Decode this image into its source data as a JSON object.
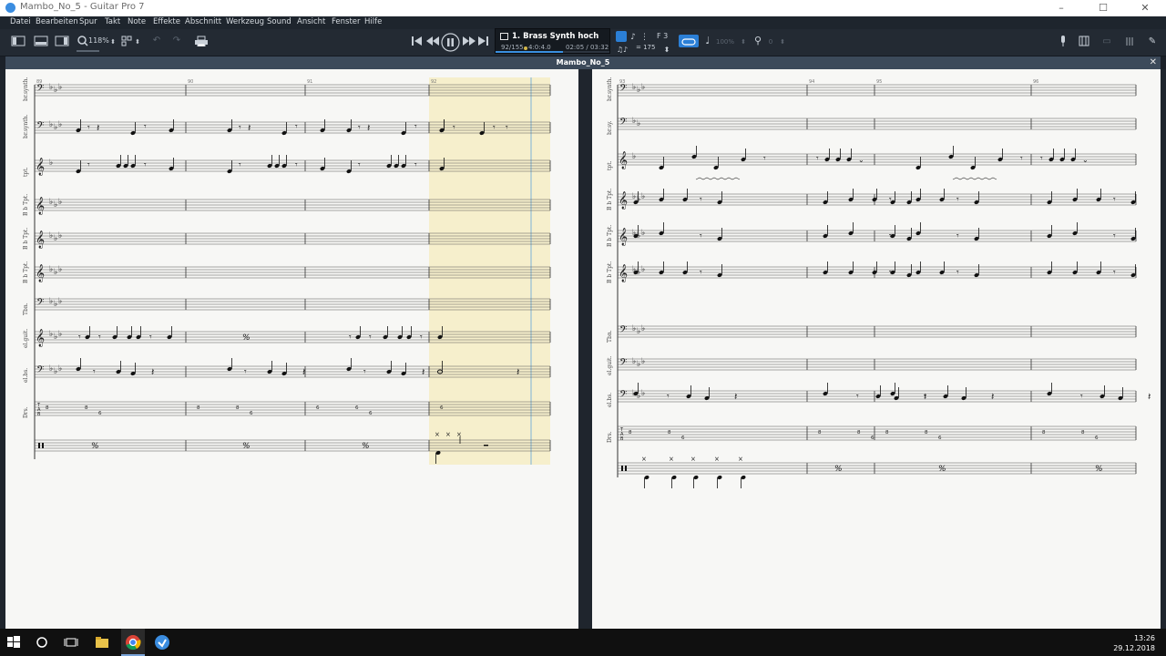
{
  "window": {
    "title": "Mambo_No_5 - Guitar Pro 7"
  },
  "menu": [
    "Datei",
    "Bearbeiten",
    "Spur",
    "Takt",
    "Note",
    "Effekte",
    "Abschnitt",
    "Werkzeug",
    "Sound",
    "Ansicht",
    "Fenster",
    "Hilfe"
  ],
  "toolbar": {
    "zoom": "118%",
    "lcd": {
      "track": "1. Brass Synth hoch",
      "bar": "92/155",
      "signature": "4:0:4.0",
      "time": "02:05 / 03:32",
      "progress_percent": 59
    },
    "tempo": "= 175",
    "key": "F 3",
    "volume": "100%",
    "pan": "0"
  },
  "document": {
    "tab": "Mambo_No_5"
  },
  "left_page": {
    "bar_numbers": [
      "89",
      "90",
      "91",
      "92"
    ],
    "tracks": [
      "br.synth.",
      "br.synth.",
      "tpt.",
      "B b Tpt.",
      "B b Tpt.",
      "B b Tpt.",
      "Tbn.",
      "el.guit.",
      "el.bs.",
      "Drs."
    ],
    "tab_clef": "T\nA\nB",
    "bass_tab": [
      {
        "nums": [
          "8",
          "8",
          "6"
        ]
      },
      {
        "nums": [
          "8",
          "8",
          "6"
        ]
      },
      {
        "nums": [
          "6",
          "6",
          "6"
        ]
      },
      {
        "nums": [
          "6"
        ]
      }
    ],
    "repeat_sign": "%"
  },
  "right_page": {
    "bar_numbers": [
      "93",
      "94",
      "95",
      "96"
    ],
    "tracks": [
      "br.synth.",
      "br.sy.",
      "tpt.",
      "B b Tpt.",
      "B b Tpt.",
      "B b Tpt.",
      "Tbn.",
      "el.guit.",
      "el.bs.",
      "Drs."
    ],
    "tab_clef": "T\nA\nB",
    "bass_tab": [
      {
        "nums": [
          "8",
          "8",
          "6"
        ]
      },
      {
        "nums": [
          "8",
          "8",
          "6"
        ]
      },
      {
        "nums": [
          "8",
          "8",
          "6"
        ]
      },
      {
        "nums": [
          "8",
          "8",
          "6"
        ]
      }
    ],
    "repeat_sign": "%"
  },
  "taskbar": {
    "time": "13:26",
    "date": "29.12.2018"
  },
  "colors": {
    "chrome_dark": "#232a33",
    "accent_blue": "#2b7fd6",
    "highlight_bar": "#f6efcc",
    "cursor": "#7fb3d8"
  }
}
